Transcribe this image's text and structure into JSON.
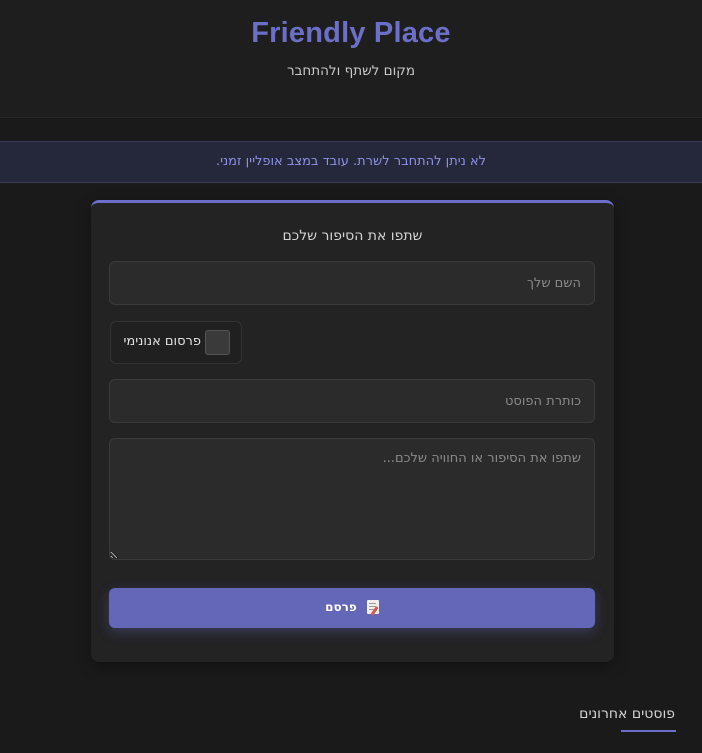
{
  "header": {
    "title": "Friendly Place",
    "subtitle": "מקום לשתף ולהתחבר"
  },
  "banner": {
    "offline_message": "לא ניתן להתחבר לשרת. עובד במצב אופליין זמני."
  },
  "form": {
    "title": "שתפו את הסיפור שלכם",
    "name_placeholder": "השם שלך",
    "anonymous_label": "פרסום אנונימי",
    "anonymous_checked": false,
    "post_title_placeholder": "כותרת הפוסט",
    "story_placeholder": "שתפו את הסיפור או החוויה שלכם...",
    "publish_label": "פרסם",
    "publish_icon": "memo-icon"
  },
  "recent": {
    "heading": "פוסטים אחרונים"
  },
  "colors": {
    "accent": "#6c6fc7",
    "button": "#6466b8",
    "background": "#1a1a1b",
    "banner_text": "#8e91e6"
  }
}
